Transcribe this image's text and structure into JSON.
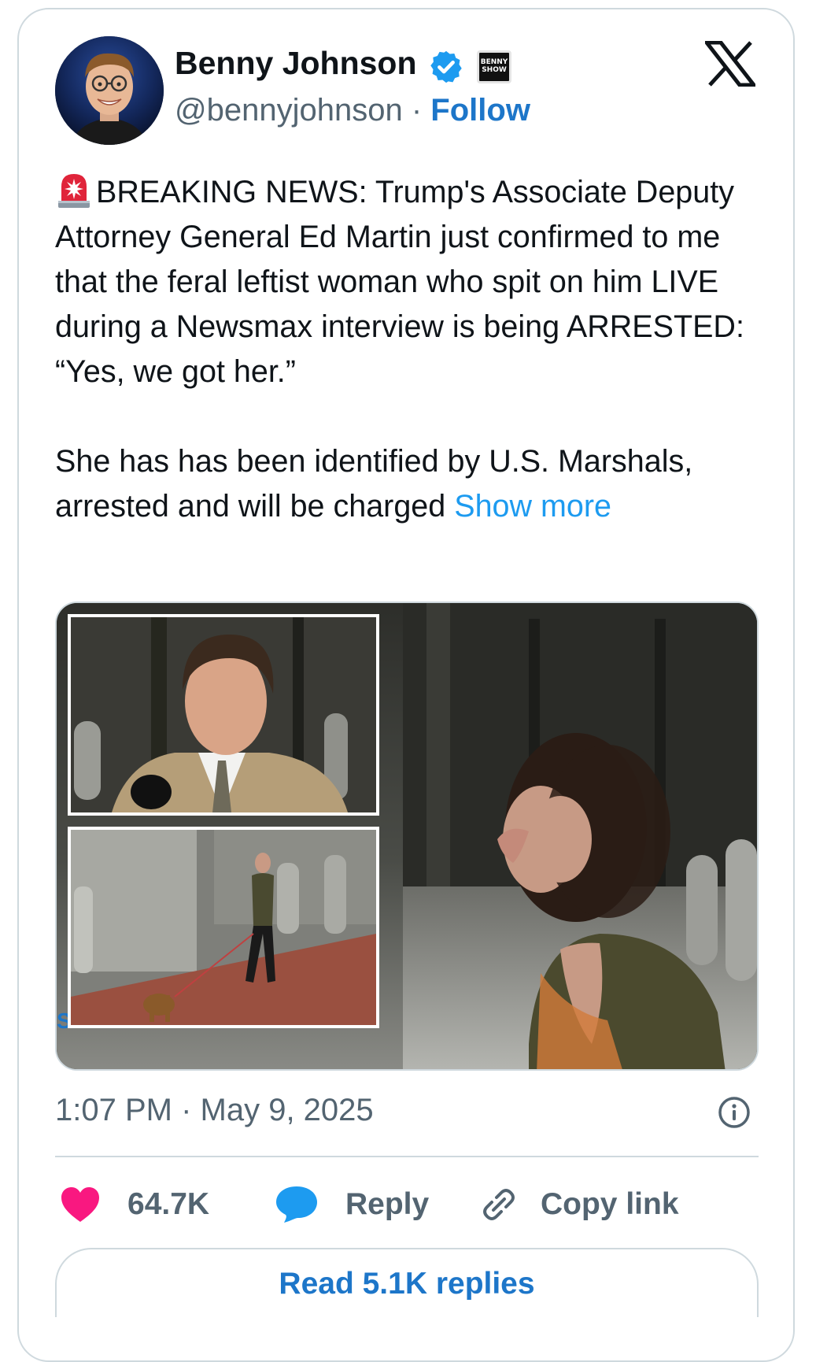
{
  "author": {
    "name": "Benny Johnson",
    "handle": "@bennyjohnson",
    "separator": "·",
    "follow_label": "Follow",
    "badge_text_line1": "BENNY",
    "badge_text_line2": "SHOW",
    "verified_color": "#1d9bf0"
  },
  "icons": {
    "verified": "verified-badge-icon",
    "x_logo": "x-logo-icon",
    "siren": "rotating-light-emoji-icon",
    "info": "info-icon",
    "heart": "heart-icon",
    "reply": "speech-bubble-icon",
    "link": "link-icon"
  },
  "tweet": {
    "text_part1": "BREAKING NEWS: Trump's Associate Deputy Attorney General Ed Martin just confirmed to me that the feral leftist woman who spit on him LIVE during a Newsmax interview is being ARRESTED: “Yes, we got her.”\n\nShe has has been identified by U.S. Marshals, arrested and will be charged ",
    "show_more": "Show more",
    "timestamp": "1:07 PM · May 9, 2025"
  },
  "media": {
    "description_icon": "video-still-image",
    "overlay_letter": "S"
  },
  "actions": {
    "likes": "64.7K",
    "reply_label": "Reply",
    "copy_label": "Copy link",
    "like_color": "#f91880",
    "reply_color": "#1d9bf0"
  },
  "footer": {
    "read_replies": "Read 5.1K replies"
  }
}
